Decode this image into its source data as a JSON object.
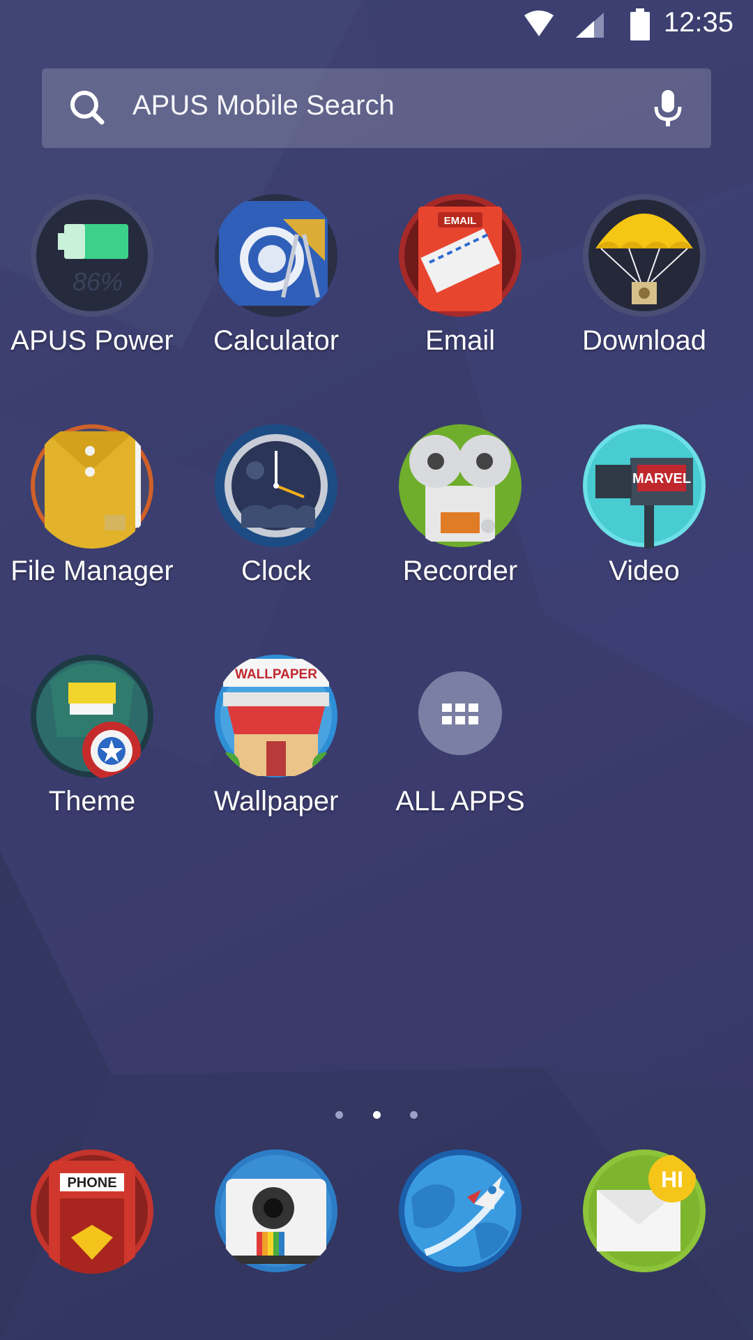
{
  "status_bar": {
    "time": "12:35",
    "icons": [
      "wifi-icon",
      "signal-icon",
      "battery-icon"
    ]
  },
  "search": {
    "placeholder": "APUS Mobile Search",
    "left_icon": "search-icon",
    "right_icon": "microphone-icon"
  },
  "apps": [
    {
      "label": "APUS Power",
      "icon": "battery-app-icon"
    },
    {
      "label": "Calculator",
      "icon": "calculator-app-icon"
    },
    {
      "label": "Email",
      "icon": "email-app-icon"
    },
    {
      "label": "Download",
      "icon": "parachute-download-icon"
    },
    {
      "label": "File Manager",
      "icon": "folder-envelope-icon"
    },
    {
      "label": "Clock",
      "icon": "clock-app-icon"
    },
    {
      "label": "Recorder",
      "icon": "reel-recorder-icon"
    },
    {
      "label": "Video",
      "icon": "movie-camera-icon"
    },
    {
      "label": "Theme",
      "icon": "monster-theme-icon"
    },
    {
      "label": "Wallpaper",
      "icon": "shop-wallpaper-icon"
    },
    {
      "label": "ALL APPS",
      "icon": "grid-all-apps-icon"
    }
  ],
  "app_badges": {
    "battery_percent": "86%",
    "email_sign": "EMAIL",
    "wallpaper_sign": "WALLPAPER",
    "marvel_text": "MARVEL"
  },
  "page_indicator": {
    "count": 3,
    "active_index": 1
  },
  "dock": [
    {
      "name": "phone",
      "icon": "phone-booth-icon",
      "sign": "PHONE"
    },
    {
      "name": "camera",
      "icon": "polaroid-camera-icon"
    },
    {
      "name": "browser",
      "icon": "globe-rocket-icon"
    },
    {
      "name": "messages",
      "icon": "envelope-hi-icon",
      "badge": "HI"
    }
  ],
  "colors": {
    "background": "#3b3d6d",
    "label_text": "#ffffff",
    "search_bg": "rgba(255,255,255,0.18)"
  }
}
